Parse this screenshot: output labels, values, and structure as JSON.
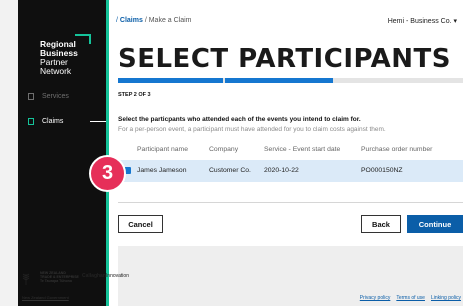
{
  "colors": {
    "accent": "#15c39a",
    "primary": "#1577d0",
    "badge": "#e62f59",
    "button": "#0b5ea8"
  },
  "sidebar": {
    "logo_lines": [
      "Regional",
      "Business",
      "Partner",
      "Network"
    ],
    "items": [
      {
        "label": "Services",
        "icon": "square-icon"
      },
      {
        "label": "Claims",
        "icon": "document-icon"
      }
    ]
  },
  "header": {
    "breadcrumb_lead": "/",
    "breadcrumb_claims": "Claims",
    "breadcrumb_current": "/ Make a Claim",
    "user_label": "Hemi - Business Co. ▾"
  },
  "page": {
    "title": "SELECT PARTICIPANTS",
    "step": "STEP 2 OF 3",
    "progress_steps_complete": 2,
    "progress_steps_total": 3,
    "intro": "Select the particpants who attended each of the events you intend to claim for.",
    "intro_sub": "For a per-person event, a participant must have attended for you to claim costs against them."
  },
  "table": {
    "headers": [
      "Participant name",
      "Company",
      "Service - Event start date",
      "Purchase order number"
    ],
    "rows": [
      {
        "selected": true,
        "cells": [
          "James Jameson",
          "Customer Co.",
          "2020-10-22",
          "PO000150NZ"
        ]
      }
    ]
  },
  "annotation": {
    "badge_number": "3"
  },
  "buttons": {
    "cancel": "Cancel",
    "back": "Back",
    "continue": "Continue"
  },
  "footer": {
    "nzte_lines": [
      "NEW ZEALAND",
      "TRADE & ENTERPRISE",
      "Te Taurapa Tūhono"
    ],
    "callaghan_bold": "Callaghan",
    "callaghan_rest": "Innovation",
    "govt": "New Zealand Government",
    "links": [
      "Privacy policy",
      "Terms of use",
      "Linking policy"
    ]
  }
}
